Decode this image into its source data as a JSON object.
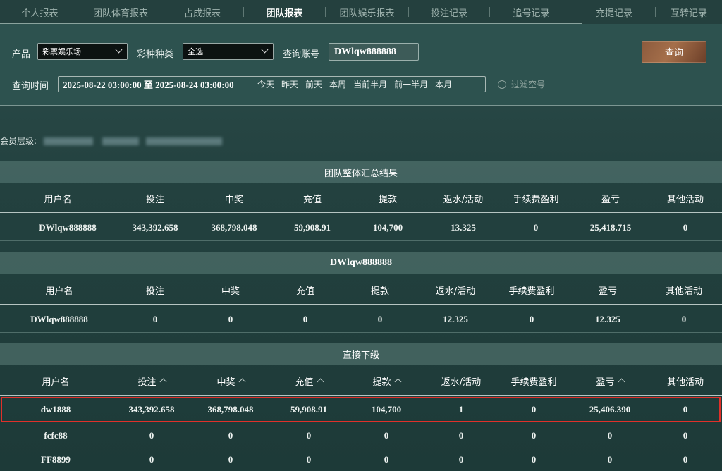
{
  "tabs": [
    "个人报表",
    "团队体育报表",
    "占成报表",
    "团队报表",
    "团队娱乐报表",
    "投注记录",
    "追号记录",
    "充提记录",
    "互转记录"
  ],
  "active_tab": 3,
  "filter": {
    "product_label": "产品",
    "product_value": "彩票娱乐场",
    "type_label": "彩种种类",
    "type_value": "全选",
    "account_label": "查询账号",
    "account_value": "DWlqw888888",
    "query_button": "查询",
    "time_label": "查询时间",
    "date_range": "2025-08-22 03:00:00 至 2025-08-24 03:00:00",
    "quick": [
      "今天",
      "昨天",
      "前天",
      "本周",
      "当前半月",
      "前一半月",
      "本月"
    ],
    "filter_empty": "过滤空号"
  },
  "member_level_label": "会员层级:",
  "columns": [
    "用户名",
    "投注",
    "中奖",
    "充值",
    "提款",
    "返水/活动",
    "手续费盈利",
    "盈亏",
    "其他活动"
  ],
  "summary": {
    "title": "团队整体汇总结果",
    "row": [
      "DWlqw888888",
      "343,392.658",
      "368,798.048",
      "59,908.91",
      "104,700",
      "13.325",
      "0",
      "25,418.715",
      "0"
    ]
  },
  "self": {
    "title": "DWlqw888888",
    "row": [
      "DWlqw888888",
      "0",
      "0",
      "0",
      "0",
      "12.325",
      "0",
      "12.325",
      "0"
    ]
  },
  "direct": {
    "title": "直接下级",
    "rows": [
      [
        "dw1888",
        "343,392.658",
        "368,798.048",
        "59,908.91",
        "104,700",
        "1",
        "0",
        "25,406.390",
        "0"
      ],
      [
        "fcfc88",
        "0",
        "0",
        "0",
        "0",
        "0",
        "0",
        "0",
        "0"
      ],
      [
        "FF8899",
        "0",
        "0",
        "0",
        "0",
        "0",
        "0",
        "0",
        "0"
      ]
    ]
  },
  "colors": {
    "highlight": "#e0302a",
    "accent": "#d9c29a",
    "button": "#a56f4a"
  }
}
